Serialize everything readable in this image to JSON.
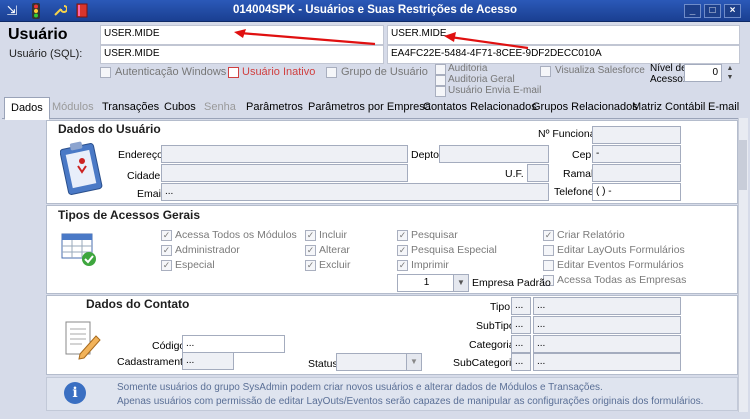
{
  "window": {
    "title": "014004SPK - Usuários e Suas Restrições de Acesso",
    "toolbar_icons": [
      "exit-icon",
      "traffic-light-icon",
      "wrench-icon",
      "book-icon"
    ],
    "controls": [
      "minimize-icon",
      "maximize-icon",
      "close-icon"
    ]
  },
  "header": {
    "usuario_label": "Usuário",
    "usuario_value": "USER.MIDE",
    "usuario_nome_value": "USER.MIDE",
    "usuario_sql_label": "Usuário (SQL):",
    "usuario_sql_value": "USER.MIDE",
    "guid_value": "EA4FC22E-5484-4F71-8CEE-9DF2DECC010A",
    "autenticacao_label": "Autenticação Windows",
    "usuario_inativo_label": "Usuário Inativo",
    "grupo_usuario_label": "Grupo de Usuário",
    "auditoria_label": "Auditoria",
    "auditoria_geral_label": "Auditoria Geral",
    "usuario_envia_email_label": "Usuário Envia E-mail",
    "visualiza_salesforce_label": "Visualiza Salesforce",
    "nivel_acesso_label_1": "Nível de",
    "nivel_acesso_label_2": "Acesso:",
    "nivel_acesso_value": "0"
  },
  "tabs": [
    {
      "label": "Dados",
      "state": "active"
    },
    {
      "label": "Módulos",
      "state": "disabled"
    },
    {
      "label": "Transações",
      "state": "normal"
    },
    {
      "label": "Cubos",
      "state": "normal"
    },
    {
      "label": "Senha",
      "state": "disabled"
    },
    {
      "label": "Parâmetros",
      "state": "normal"
    },
    {
      "label": "Parâmetros por Empresa",
      "state": "normal"
    },
    {
      "label": "Contatos Relacionados",
      "state": "normal"
    },
    {
      "label": "Grupos Relacionados",
      "state": "normal"
    },
    {
      "label": "Matriz Contábil",
      "state": "normal"
    },
    {
      "label": "E-mail",
      "state": "normal"
    }
  ],
  "dados_usuario": {
    "title": "Dados do Usuário",
    "nr_funcional_label": "Nº Funcional",
    "nr_funcional_value": "",
    "endereco_label": "Endereço",
    "endereco_value": "",
    "depto_label": "Depto",
    "depto_value": "",
    "cep_label": "Cep",
    "cep_value": "-",
    "cidade_label": "Cidade",
    "cidade_value": "",
    "uf_label": "U.F.",
    "uf_value": "",
    "ramal_label": "Ramal",
    "ramal_value": "",
    "email_label": "Email",
    "email_value": "...",
    "telefone_label": "Telefone",
    "telefone_value": "(  )   -"
  },
  "tipos_acesso": {
    "title": "Tipos de Acessos Gerais",
    "options": [
      {
        "label": "Acessa Todos os Módulos",
        "checked": true
      },
      {
        "label": "Administrador",
        "checked": true
      },
      {
        "label": "Especial",
        "checked": true
      },
      {
        "label": "Incluir",
        "checked": true
      },
      {
        "label": "Alterar",
        "checked": true
      },
      {
        "label": "Excluir",
        "checked": true
      },
      {
        "label": "Pesquisar",
        "checked": true
      },
      {
        "label": "Pesquisa Especial",
        "checked": true
      },
      {
        "label": "Imprimir",
        "checked": true
      },
      {
        "label": "Criar Relatório",
        "checked": true
      },
      {
        "label": "Editar LayOuts Formulários",
        "checked": false
      },
      {
        "label": "Editar Eventos Formulários",
        "checked": false
      },
      {
        "label": "Acessa Todas as Empresas",
        "checked": false
      }
    ],
    "empresa_padrao_value": "1",
    "empresa_padrao_label": "Empresa Padrão"
  },
  "dados_contato": {
    "title": "Dados do Contato",
    "codigo_label": "Código",
    "codigo_value": "...",
    "cadastramento_label": "Cadastramento",
    "cadastramento_value": "...",
    "status_label": "Status",
    "status_value": "",
    "tipo_label": "Tipo",
    "tipo_value": "...",
    "subtipo_label": "SubTipo",
    "subtipo_value": "...",
    "categoria_label": "Categoria",
    "categoria_value": "...",
    "subcategoria_label": "SubCategoria",
    "subcategoria_value": "..."
  },
  "info": {
    "line1": "Somente usuários do grupo SysAdmin podem criar novos usuários e alterar dados de Módulos e Transações.",
    "line2": "Apenas usuários com permissão de editar LayOuts/Eventos serão capazes de manipular as configurações originais dos formulários."
  },
  "colors": {
    "titlebar": "#1a3f91",
    "arrow": "#e01010",
    "inactive_red": "#d04040"
  }
}
